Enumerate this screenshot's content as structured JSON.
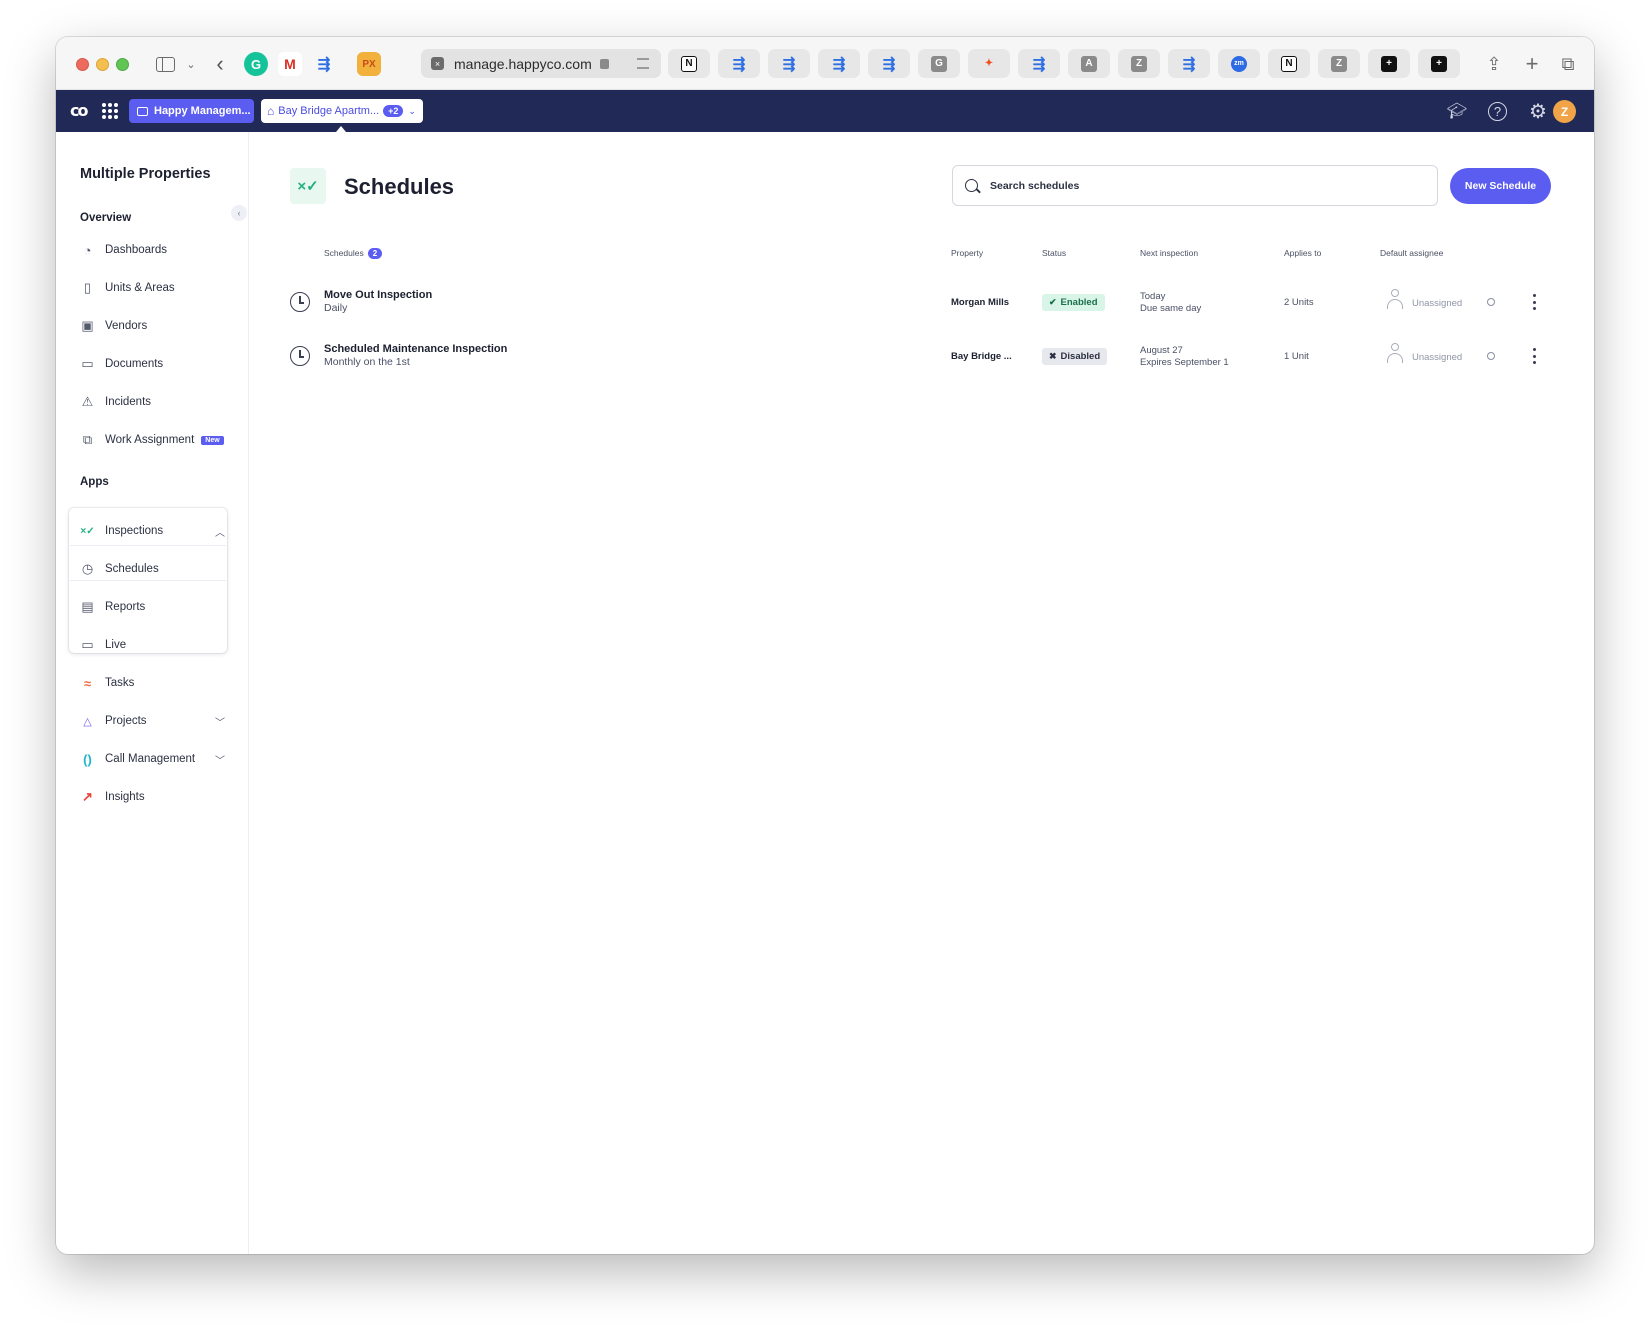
{
  "browser": {
    "url": "manage.happyco.com",
    "extensions": [
      "grammarly-icon",
      "gmail-icon",
      "jira-icon",
      "px-icon"
    ],
    "ext_labels": {
      "px": "PX"
    },
    "tabs": [
      {
        "icon": "notion-icon",
        "label": "N"
      },
      {
        "icon": "jira-icon",
        "label": ""
      },
      {
        "icon": "jira-icon",
        "label": ""
      },
      {
        "icon": "jira-icon",
        "label": ""
      },
      {
        "icon": "jira-icon",
        "label": ""
      },
      {
        "icon": "g-icon",
        "label": "G"
      },
      {
        "icon": "figma-icon",
        "label": ""
      },
      {
        "icon": "jira-icon",
        "label": ""
      },
      {
        "icon": "a-icon",
        "label": "A"
      },
      {
        "icon": "z-icon",
        "label": "Z"
      },
      {
        "icon": "jira-icon",
        "label": ""
      },
      {
        "icon": "zoom-icon",
        "label": "zm"
      },
      {
        "icon": "notion-icon",
        "label": "N"
      },
      {
        "icon": "z-icon",
        "label": "Z"
      },
      {
        "icon": "plus-square-icon",
        "label": "+"
      },
      {
        "icon": "plus-square-icon",
        "label": "+"
      }
    ]
  },
  "appbar": {
    "org": "Happy Managem...",
    "property": "Bay Bridge Apartm...",
    "property_extra": "+2",
    "avatar_initial": "Z",
    "colors": {
      "bar": "#212a56",
      "accent": "#5b5cf0"
    }
  },
  "sidebar": {
    "title": "Multiple Properties",
    "overview_label": "Overview",
    "overview_items": [
      {
        "label": "Dashboards",
        "icon": "pie-chart-icon"
      },
      {
        "label": "Units & Areas",
        "icon": "door-icon"
      },
      {
        "label": "Vendors",
        "icon": "vendor-badge-icon"
      },
      {
        "label": "Documents",
        "icon": "folder-icon"
      },
      {
        "label": "Incidents",
        "icon": "warning-icon"
      },
      {
        "label": "Work Assignment",
        "icon": "assignment-icon",
        "badge": "New"
      }
    ],
    "apps_label": "Apps",
    "apps_items": [
      {
        "label": "Inspections",
        "icon": "inspections-icon",
        "expanded": true
      },
      {
        "label": "Schedules",
        "icon": "schedule-clock-icon",
        "selected": true
      },
      {
        "label": "Reports",
        "icon": "report-icon"
      },
      {
        "label": "Live",
        "icon": "video-icon"
      },
      {
        "label": "Tasks",
        "icon": "tasks-icon"
      },
      {
        "label": "Projects",
        "icon": "projects-icon"
      },
      {
        "label": "Call Management",
        "icon": "call-icon"
      },
      {
        "label": "Insights",
        "icon": "insights-arrow-icon"
      }
    ]
  },
  "main": {
    "title": "Schedules",
    "search_placeholder": "Search schedules",
    "new_button": "New Schedule",
    "columns": {
      "schedules": "Schedules",
      "count": "2",
      "property": "Property",
      "status": "Status",
      "next": "Next inspection",
      "applies": "Applies to",
      "assignee": "Default assignee"
    },
    "rows": [
      {
        "name": "Move Out Inspection",
        "frequency": "Daily",
        "property": "Morgan Mills",
        "status": "Enabled",
        "next_line1": "Today",
        "next_line2": "Due same day",
        "applies": "2 Units",
        "assignee": "Unassigned"
      },
      {
        "name": "Scheduled Maintenance Inspection",
        "frequency": "Monthly on the 1st",
        "property": "Bay Bridge ...",
        "status": "Disabled",
        "next_line1": "August 27",
        "next_line2": "Expires September 1",
        "applies": "1 Unit",
        "assignee": "Unassigned"
      }
    ]
  }
}
